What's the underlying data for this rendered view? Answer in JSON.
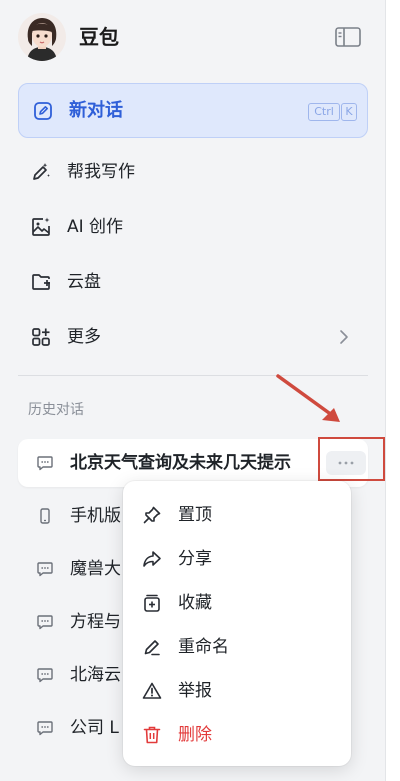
{
  "app": {
    "name": "豆包"
  },
  "new_chat": {
    "label": "新对话",
    "shortcut_ctrl": "Ctrl",
    "shortcut_key": "K"
  },
  "nav": [
    {
      "label": "帮我写作",
      "icon": "write-icon"
    },
    {
      "label": "AI 创作",
      "icon": "image-create-icon"
    },
    {
      "label": "云盘",
      "icon": "cloud-drive-icon"
    },
    {
      "label": "更多",
      "icon": "more-apps-icon"
    }
  ],
  "history": {
    "title": "历史对话",
    "items": [
      {
        "label": "北京天气查询及未来几天提示",
        "icon": "chat-icon",
        "active": true
      },
      {
        "label": "手机版",
        "icon": "phone-icon"
      },
      {
        "label": "魔兽大",
        "icon": "chat-icon"
      },
      {
        "label": "方程与",
        "icon": "chat-icon"
      },
      {
        "label": "北海云",
        "icon": "chat-icon"
      },
      {
        "label": "公司 L",
        "icon": "chat-icon"
      }
    ]
  },
  "context_menu": {
    "items": [
      {
        "label": "置顶",
        "icon": "pin-icon"
      },
      {
        "label": "分享",
        "icon": "share-icon"
      },
      {
        "label": "收藏",
        "icon": "collect-icon"
      },
      {
        "label": "重命名",
        "icon": "rename-icon"
      },
      {
        "label": "举报",
        "icon": "report-icon"
      },
      {
        "label": "删除",
        "icon": "delete-icon",
        "danger": true
      }
    ]
  },
  "colors": {
    "accent": "#2f5fd8",
    "new_chat_bg": "#dfe8fc",
    "sidebar_bg": "#f3f4f6",
    "danger": "#e23b3b",
    "annotation": "#cf4a3e"
  }
}
